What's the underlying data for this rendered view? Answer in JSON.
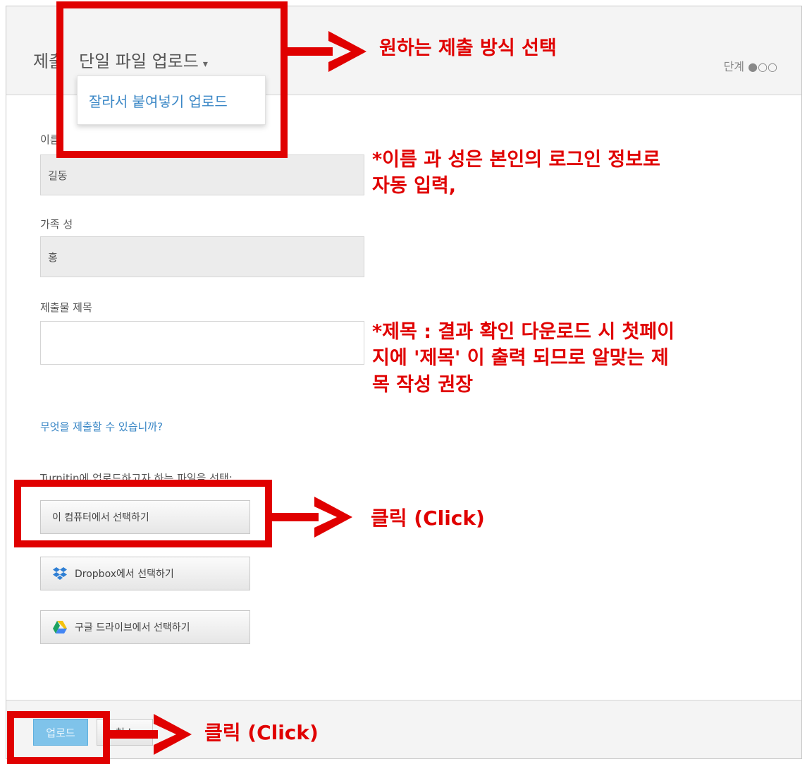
{
  "header": {
    "title": "제출",
    "mode_label": "단일 파일 업로드",
    "step": "단계 ●○○"
  },
  "dropdown": {
    "option": "잘라서 붙여넣기 업로드"
  },
  "form": {
    "first_name_label": "이름",
    "first_name_value": "길동",
    "last_name_label": "가족 성",
    "last_name_value": "홍",
    "title_label": "제출물 제목",
    "title_value": "",
    "help_link": "무엇을 제출할 수 있습니까?",
    "upload_prompt": "Turnitin에 업로드하고자 하는 파일을 선택:",
    "upload_computer": "이 컴퓨터에서 선택하기",
    "upload_dropbox": "Dropbox에서 선택하기",
    "upload_gdrive": "구글 드라이브에서 선택하기"
  },
  "footer": {
    "submit": "업로드",
    "cancel": "취소"
  },
  "annotations": {
    "choose_method": "원하는 제출 방식 선택",
    "name_note_line1": "*이름 과 성은 본인의 로그인 정보로",
    "name_note_line2": "자동 입력,",
    "title_note_line1": "*제목 : 결과 확인 다운로드 시 첫페이",
    "title_note_line2": "지에 '제목' 이 출력 되므로 알맞는 제",
    "title_note_line3": "목 작성 권장",
    "click_upload": "클릭 (Click)",
    "click_submit": "클릭 (Click)"
  },
  "colors": {
    "annotation_red": "#e00000",
    "link_blue": "#3a87c6",
    "submit_blue": "#7fc3ea"
  }
}
